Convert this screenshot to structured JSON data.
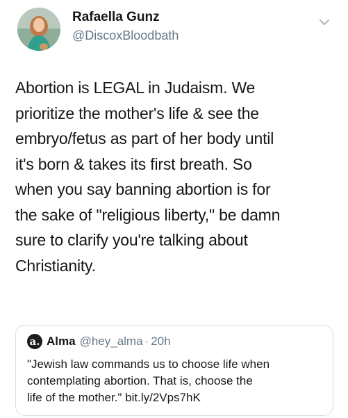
{
  "author": {
    "name": "Rafaella Gunz",
    "handle": "@DiscoxBloodbath"
  },
  "tweet": {
    "lines": [
      "Abortion is LEGAL in Judaism. We",
      "prioritize the mother's life & see the",
      "embryo/fetus as part of her body until",
      "it's born & takes its first breath. So",
      "when you say banning abortion is for",
      "the sake of \"religious liberty,\" be damn",
      "sure to clarify you're talking about",
      "Christianity."
    ]
  },
  "quoted": {
    "avatar_letter": "a.",
    "name": "Alma",
    "handle": "@hey_alma",
    "separator": "·",
    "time": "20h",
    "lines": [
      "\"Jewish law commands us to choose life when",
      "contemplating abortion. That is, choose the",
      "life of the mother.\" bit.ly/2Vps7hK"
    ]
  },
  "icons": {
    "menu": "chevron-down-icon"
  }
}
